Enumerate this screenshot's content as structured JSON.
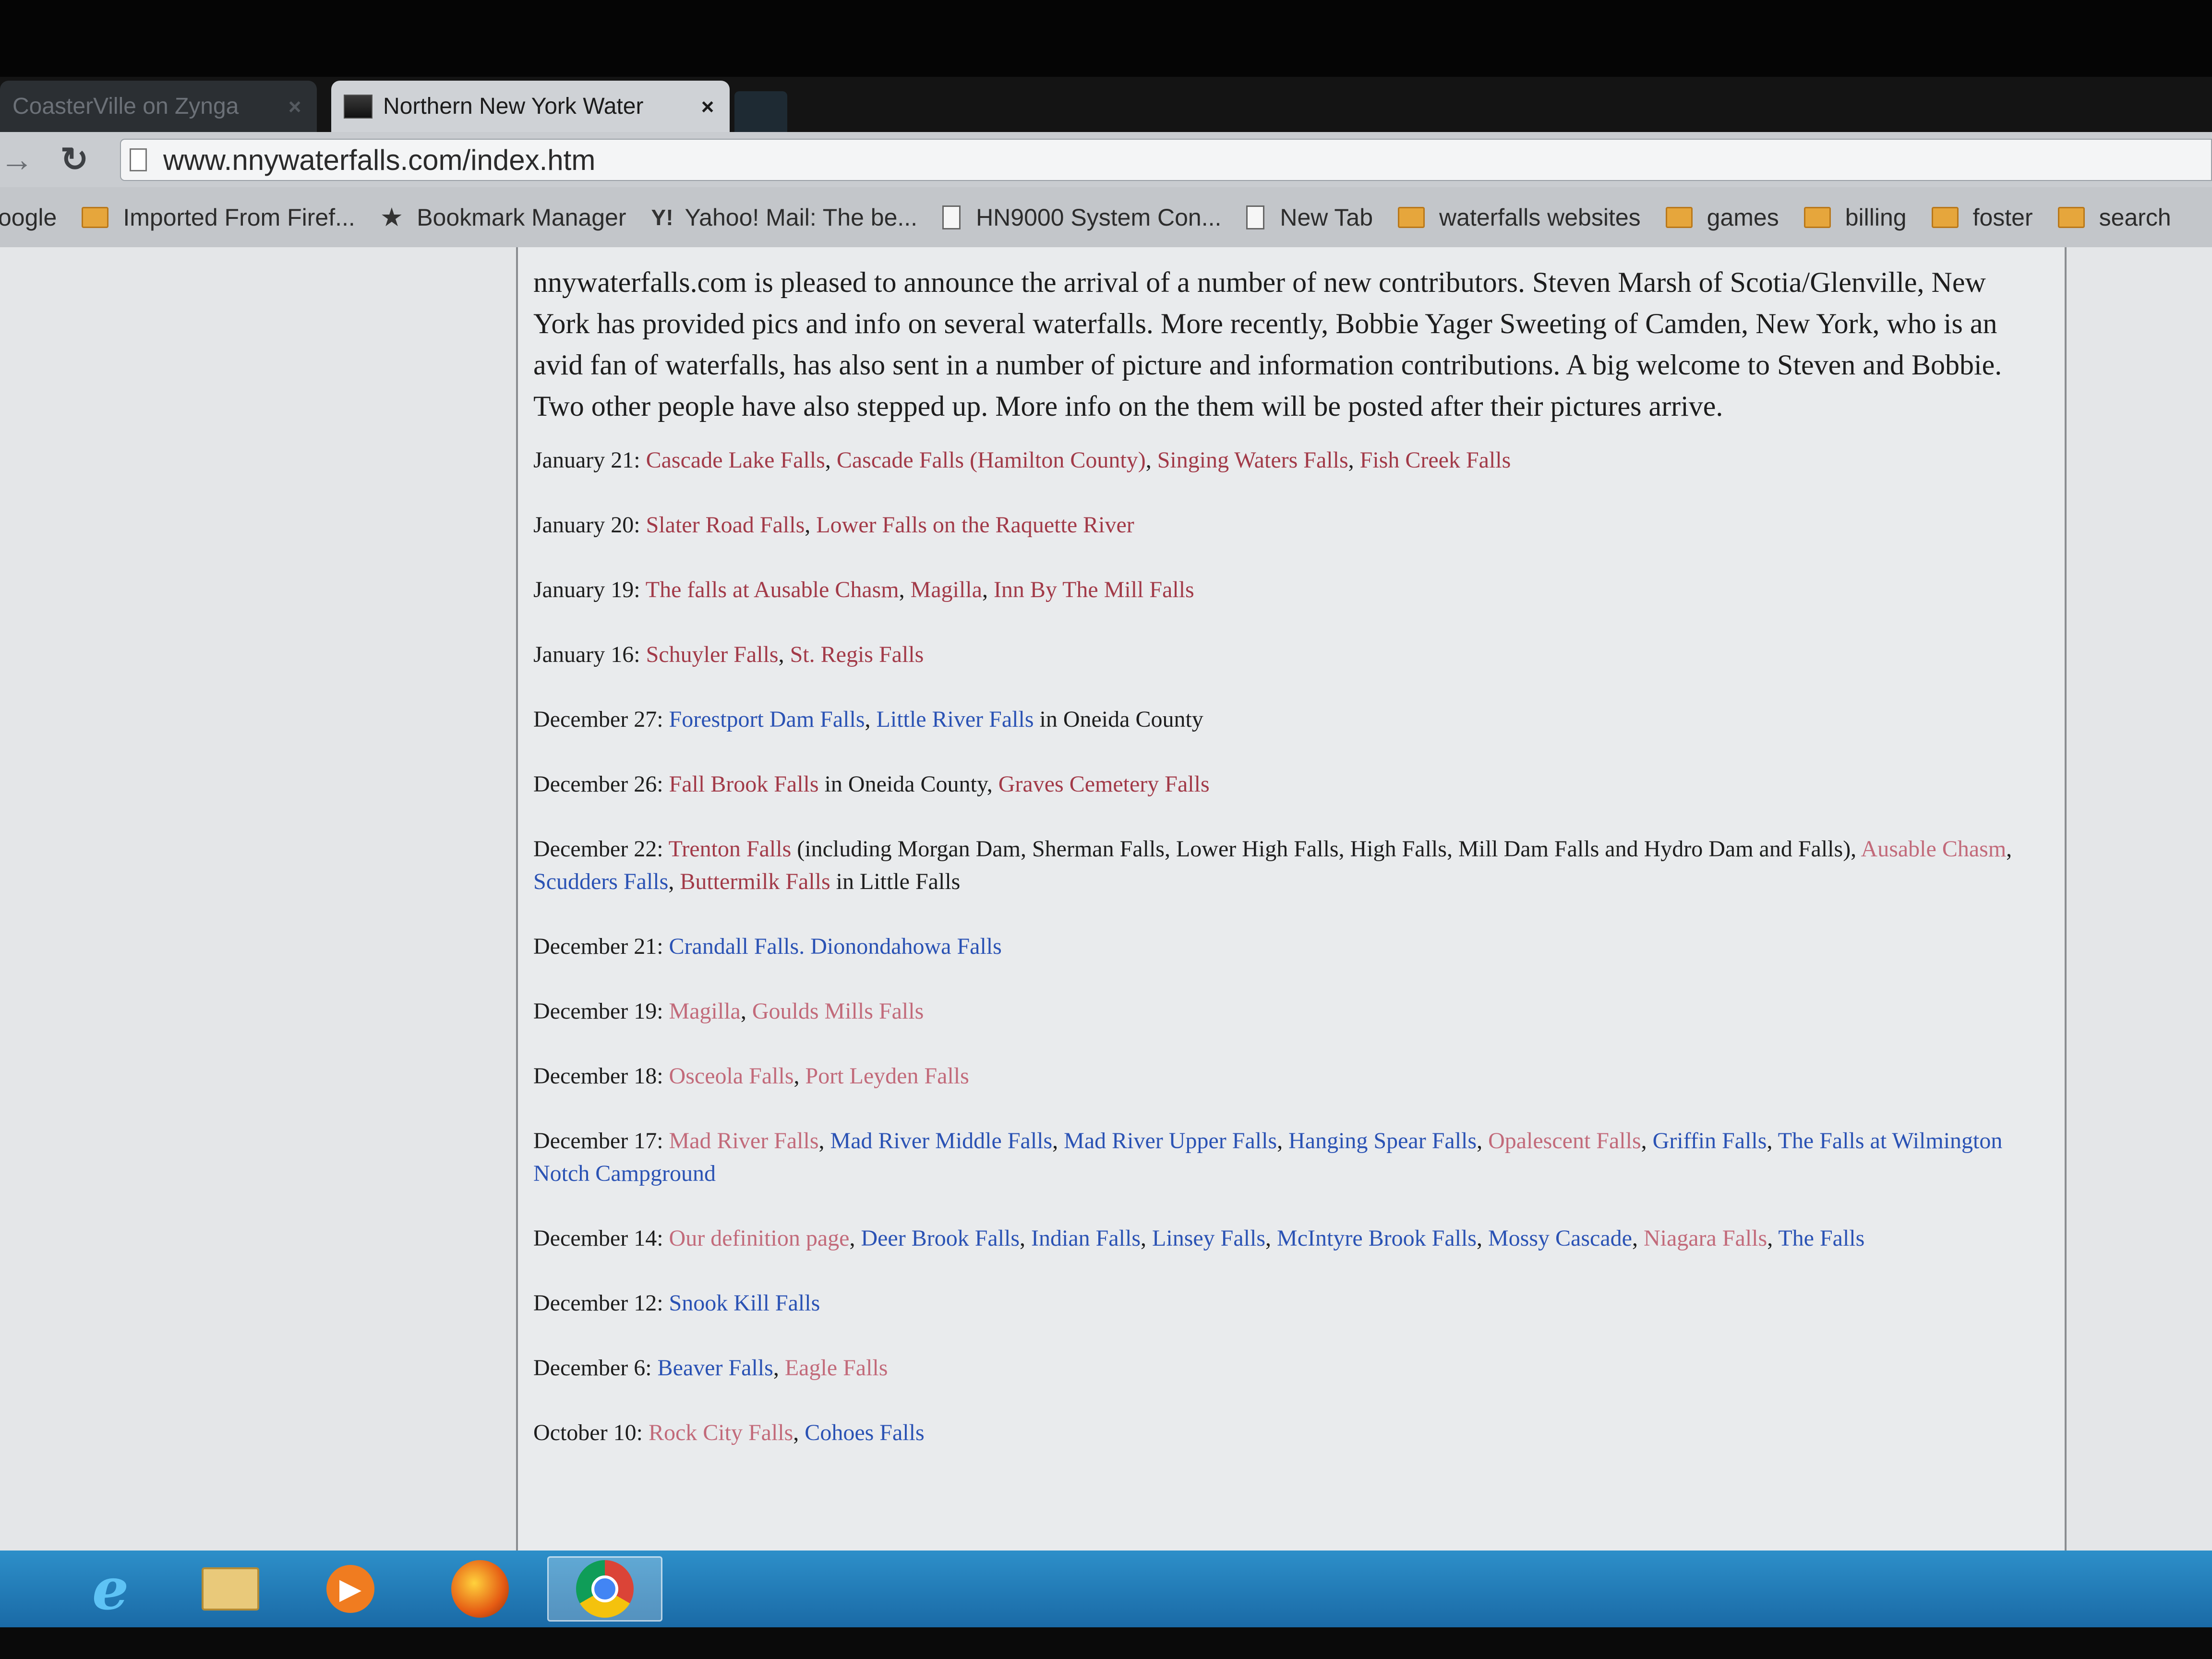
{
  "browser": {
    "tabs": [
      {
        "label": "CoasterVille on Zynga",
        "active": false
      },
      {
        "label": "Northern New York Water",
        "active": true
      }
    ],
    "tab_close_glyph": "×",
    "url": "www.nnywaterfalls.com/index.htm",
    "bookmarks": [
      {
        "label": "oogle",
        "icon": "none"
      },
      {
        "label": "Imported From Firef...",
        "icon": "folder-icon"
      },
      {
        "label": "Bookmark Manager",
        "icon": "star-icon"
      },
      {
        "label": "Yahoo! Mail: The be...",
        "icon": "yahoo-icon"
      },
      {
        "label": "HN9000 System Con...",
        "icon": "document-icon"
      },
      {
        "label": "New Tab",
        "icon": "document-icon"
      },
      {
        "label": "waterfalls websites",
        "icon": "folder-icon"
      },
      {
        "label": "games",
        "icon": "folder-icon"
      },
      {
        "label": "billing",
        "icon": "folder-icon"
      },
      {
        "label": "foster",
        "icon": "folder-icon"
      },
      {
        "label": "search",
        "icon": "folder-icon"
      }
    ]
  },
  "page": {
    "intro": "nnywaterfalls.com is pleased to announce the arrival of a number of new contributors.  Steven Marsh of Scotia/Glenville, New York has provided pics and info on several waterfalls.  More recently, Bobbie Yager Sweeting of Camden, New York, who is an avid fan of waterfalls, has also sent in a number of picture and information contributions.  A big welcome to Steven and Bobbie.  Two other people have also stepped up.  More info on the them will be posted after their pictures arrive.",
    "updates": [
      {
        "date": "January 21:  ",
        "parts": [
          {
            "t": "Cascade Lake Falls",
            "k": "lr"
          },
          {
            "t": ", ",
            "k": "plain"
          },
          {
            "t": "Cascade Falls (Hamilton County)",
            "k": "lr"
          },
          {
            "t": ", ",
            "k": "plain"
          },
          {
            "t": "Singing Waters Falls",
            "k": "lr"
          },
          {
            "t": ", ",
            "k": "plain"
          },
          {
            "t": "Fish Creek Falls",
            "k": "lr"
          }
        ]
      },
      {
        "date": "January 20:  ",
        "parts": [
          {
            "t": "Slater Road Falls",
            "k": "lr"
          },
          {
            "t": ",  ",
            "k": "plain"
          },
          {
            "t": "Lower Falls on the Raquette River",
            "k": "lr"
          }
        ]
      },
      {
        "date": "January 19:  ",
        "parts": [
          {
            "t": "The falls at Ausable Chasm",
            "k": "lr"
          },
          {
            "t": ", ",
            "k": "plain"
          },
          {
            "t": "Magilla",
            "k": "lr"
          },
          {
            "t": ", ",
            "k": "plain"
          },
          {
            "t": "Inn By The Mill Falls",
            "k": "lr"
          }
        ]
      },
      {
        "date": "January 16:  ",
        "parts": [
          {
            "t": "Schuyler Falls",
            "k": "lr"
          },
          {
            "t": ", ",
            "k": "plain"
          },
          {
            "t": "St. Regis Falls",
            "k": "lr"
          }
        ]
      },
      {
        "date": "December 27:  ",
        "parts": [
          {
            "t": "Forestport Dam Falls",
            "k": "lb"
          },
          {
            "t": ", ",
            "k": "plain"
          },
          {
            "t": "Little River Falls",
            "k": "lb"
          },
          {
            "t": " in Oneida County",
            "k": "plain"
          }
        ]
      },
      {
        "date": "December 26:  ",
        "parts": [
          {
            "t": "Fall Brook Falls",
            "k": "lr"
          },
          {
            "t": " in Oneida County, ",
            "k": "plain"
          },
          {
            "t": "Graves Cemetery Falls",
            "k": "lr"
          }
        ]
      },
      {
        "date": "December 22:  ",
        "parts": [
          {
            "t": "Trenton Falls",
            "k": "lr"
          },
          {
            "t": " (including Morgan Dam, Sherman Falls, Lower High Falls, High Falls, Mill Dam Falls and Hydro Dam and Falls), ",
            "k": "plain"
          },
          {
            "t": "Ausable Chasm",
            "k": "lp"
          },
          {
            "t": ", ",
            "k": "plain"
          },
          {
            "t": "Scudders Falls",
            "k": "lb"
          },
          {
            "t": ", ",
            "k": "plain"
          },
          {
            "t": "Buttermilk Falls",
            "k": "lr"
          },
          {
            "t": " in Little Falls",
            "k": "plain"
          }
        ]
      },
      {
        "date": "December 21: ",
        "parts": [
          {
            "t": "Crandall Falls",
            "k": "lb"
          },
          {
            "t": ". ",
            "k": "lb"
          },
          {
            "t": "Dionondahowa Falls",
            "k": "lb"
          }
        ]
      },
      {
        "date": "December 19: ",
        "parts": [
          {
            "t": "Magilla",
            "k": "lp"
          },
          {
            "t": ",  ",
            "k": "plain"
          },
          {
            "t": "Goulds Mills Falls",
            "k": "lp"
          }
        ]
      },
      {
        "date": "December 18:  ",
        "parts": [
          {
            "t": "Osceola Falls",
            "k": "lp"
          },
          {
            "t": ", ",
            "k": "plain"
          },
          {
            "t": "Port Leyden Falls",
            "k": "lp"
          }
        ]
      },
      {
        "date": "December 17:  ",
        "parts": [
          {
            "t": "Mad River Falls",
            "k": "lp"
          },
          {
            "t": ", ",
            "k": "plain"
          },
          {
            "t": "Mad River Middle Falls",
            "k": "lb"
          },
          {
            "t": ", ",
            "k": "plain"
          },
          {
            "t": "Mad River Upper Falls",
            "k": "lb"
          },
          {
            "t": ", ",
            "k": "plain"
          },
          {
            "t": "Hanging Spear Falls",
            "k": "lb"
          },
          {
            "t": ", ",
            "k": "plain"
          },
          {
            "t": "Opalescent Falls",
            "k": "lp"
          },
          {
            "t": ", ",
            "k": "plain"
          },
          {
            "t": "Griffin Falls",
            "k": "lb"
          },
          {
            "t": ", ",
            "k": "plain"
          },
          {
            "t": "The Falls at Wilmington Notch Campground",
            "k": "lb"
          }
        ]
      },
      {
        "date": "December 14:  ",
        "parts": [
          {
            "t": "Our definition page",
            "k": "lp"
          },
          {
            "t": ", ",
            "k": "plain"
          },
          {
            "t": "Deer Brook Falls",
            "k": "lb"
          },
          {
            "t": ", ",
            "k": "plain"
          },
          {
            "t": "Indian Falls",
            "k": "lb"
          },
          {
            "t": ", ",
            "k": "plain"
          },
          {
            "t": "Linsey Falls",
            "k": "lb"
          },
          {
            "t": ", ",
            "k": "plain"
          },
          {
            "t": "McIntyre Brook Falls",
            "k": "lb"
          },
          {
            "t": ", ",
            "k": "plain"
          },
          {
            "t": "Mossy Cascade",
            "k": "lb"
          },
          {
            "t": ", ",
            "k": "plain"
          },
          {
            "t": "Niagara Falls",
            "k": "lp"
          },
          {
            "t": ", ",
            "k": "plain"
          },
          {
            "t": "The Falls",
            "k": "lb"
          }
        ]
      },
      {
        "date": "December 12:  ",
        "parts": [
          {
            "t": "Snook Kill Falls",
            "k": "lb"
          }
        ]
      },
      {
        "date": "December 6:  ",
        "parts": [
          {
            "t": "Beaver Falls",
            "k": "lb"
          },
          {
            "t": ", ",
            "k": "plain"
          },
          {
            "t": "Eagle Falls",
            "k": "lp"
          }
        ]
      },
      {
        "date": "October 10:  ",
        "parts": [
          {
            "t": "Rock City Falls",
            "k": "lp"
          },
          {
            "t": ", ",
            "k": "plain"
          },
          {
            "t": "Cohoes Falls",
            "k": "lb"
          }
        ]
      }
    ]
  },
  "taskbar": {
    "items": [
      {
        "name": "internet-explorer-icon"
      },
      {
        "name": "windows-explorer-icon"
      },
      {
        "name": "media-player-icon"
      },
      {
        "name": "firefox-icon"
      },
      {
        "name": "chrome-icon",
        "active": true
      }
    ]
  },
  "colors": {
    "link_red": "#a23a48",
    "link_blue": "#2a52b4",
    "link_pink": "#c26a7a",
    "taskbar": "#2d8fc9"
  }
}
